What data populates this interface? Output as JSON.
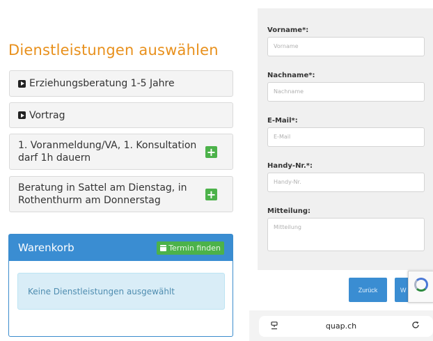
{
  "left": {
    "heading": "Dienstleistungen auswählen",
    "services": [
      {
        "label": "Erziehungsberatung 1-5 Jahre",
        "type": "category"
      },
      {
        "label": "Vortrag",
        "type": "category"
      },
      {
        "label": "1. Voranmeldung/VA, 1. Konsultation darf 1h dauern",
        "type": "item"
      },
      {
        "label": "Beratung in Sattel am Dienstag, in Rothenthurm am Donnerstag",
        "type": "item"
      }
    ],
    "cart": {
      "title": "Warenkorb",
      "button": "Termin finden",
      "empty_message": "Keine Dienstleistungen ausgewählt"
    }
  },
  "form": {
    "fields": [
      {
        "label": "Vorname*:",
        "placeholder": "Vorname"
      },
      {
        "label": "Nachname*:",
        "placeholder": "Nachname"
      },
      {
        "label": "E-Mail*:",
        "placeholder": "E-Mail"
      },
      {
        "label": "Handy-Nr.*:",
        "placeholder": "Handy-Nr."
      },
      {
        "label": "Mitteilung:",
        "placeholder": "Mitteilung"
      }
    ],
    "back_button": "Zurück",
    "next_button": "W"
  },
  "browser": {
    "url": "quap.ch"
  },
  "colors": {
    "heading": "#e8901c",
    "primary": "#3a8dd2",
    "success": "#4cb24a",
    "info_bg": "#d9edf7"
  }
}
